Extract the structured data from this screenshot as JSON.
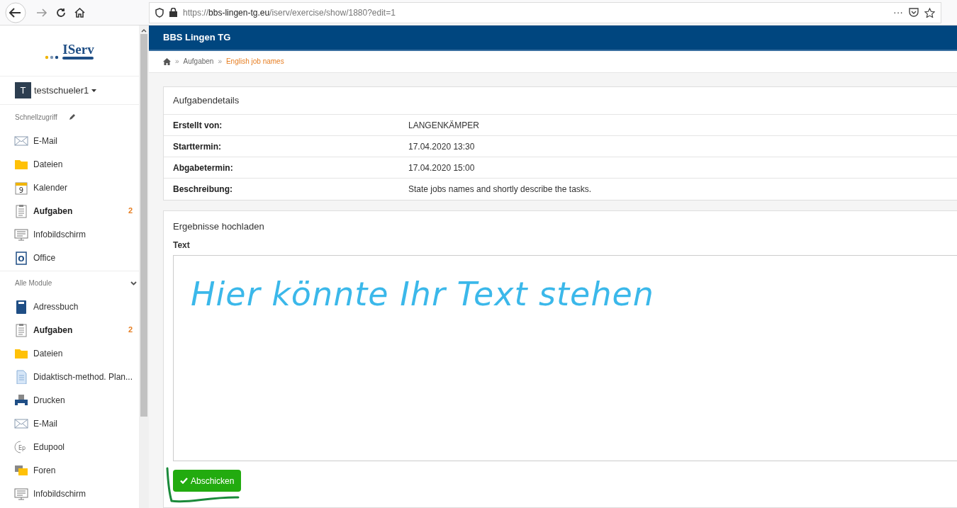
{
  "browser": {
    "url_scheme": "https://",
    "url_domain": "bbs-lingen-tg.eu",
    "url_path": "/iserv/exercise/show/1880?edit=1",
    "menu": "···"
  },
  "sidebar": {
    "logo": "IServ",
    "user": {
      "initial": "T",
      "name": "testschueler1"
    },
    "quick_title": "Schnellzugriff",
    "quick_items": [
      {
        "kind": "mail",
        "label": "E-Mail",
        "active": false
      },
      {
        "kind": "folder",
        "label": "Dateien",
        "active": false
      },
      {
        "kind": "calendar",
        "label": "Kalender",
        "active": false,
        "icon_text": "9"
      },
      {
        "kind": "tasks",
        "label": "Aufgaben",
        "active": true,
        "badge": "2"
      },
      {
        "kind": "screen",
        "label": "Infobildschirm",
        "active": false
      },
      {
        "kind": "office",
        "label": "Office",
        "active": false,
        "icon_text": "O"
      }
    ],
    "modules_title": "Alle Module",
    "module_items": [
      {
        "kind": "book",
        "label": "Adressbuch",
        "active": false
      },
      {
        "kind": "tasks",
        "label": "Aufgaben",
        "active": true,
        "badge": "2"
      },
      {
        "kind": "folder",
        "label": "Dateien",
        "active": false
      },
      {
        "kind": "document",
        "label": "Didaktisch-method. Plan...",
        "active": false
      },
      {
        "kind": "printer",
        "label": "Drucken",
        "active": false
      },
      {
        "kind": "mail",
        "label": "E-Mail",
        "active": false
      },
      {
        "kind": "edupool",
        "label": "Edupool",
        "active": false,
        "icon_text": "Ep"
      },
      {
        "kind": "forum",
        "label": "Foren",
        "active": false
      },
      {
        "kind": "screen",
        "label": "Infobildschirm",
        "active": false
      }
    ]
  },
  "header": {
    "title": "BBS Lingen TG"
  },
  "breadcrumb": [
    "Aufgaben",
    "English job names"
  ],
  "breadcrumb_separator": "»",
  "details": {
    "title": "Aufgabendetails",
    "rows": [
      {
        "label": "Erstellt von:",
        "value": "LANGENKÄMPER"
      },
      {
        "label": "Starttermin:",
        "value": "17.04.2020 13:30"
      },
      {
        "label": "Abgabetermin:",
        "value": "17.04.2020 15:00"
      },
      {
        "label": "Beschreibung:",
        "value": "State jobs names and shortly describe the tasks."
      }
    ]
  },
  "upload": {
    "title": "Ergebnisse hochladen",
    "field_label": "Text",
    "value": "Hier könnte Ihr Text stehen",
    "submit": "Abschicken"
  }
}
